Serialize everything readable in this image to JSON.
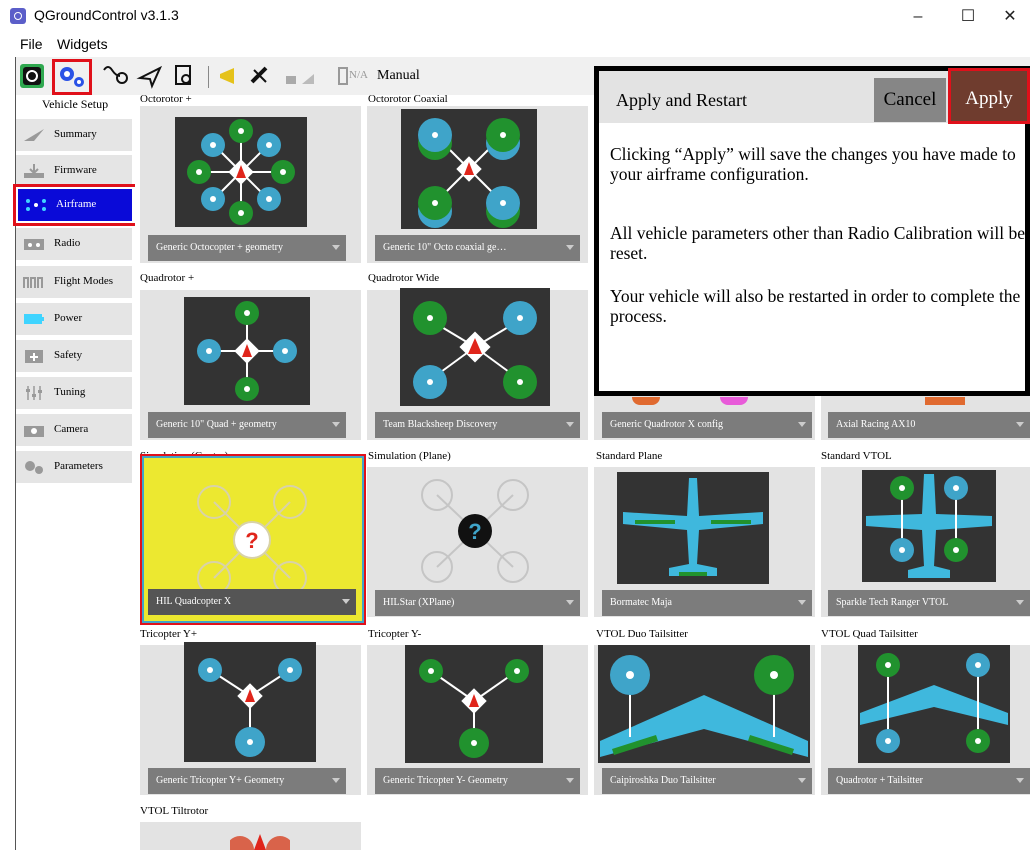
{
  "window": {
    "title": "QGroundControl v3.1.3",
    "minimize": "–",
    "maximize": "☐",
    "close": "✕"
  },
  "menu": {
    "file": "File",
    "widgets": "Widgets"
  },
  "toolbar": {
    "battery": "N/A",
    "mode": "Manual"
  },
  "nav": {
    "header": "Vehicle Setup",
    "items": [
      "Summary",
      "Firmware",
      "Airframe",
      "Radio",
      "Flight Modes",
      "Power",
      "Safety",
      "Tuning",
      "Camera",
      "Parameters"
    ],
    "selected": "Airframe"
  },
  "airframes": {
    "row0": [
      {
        "title": "Octorotor +",
        "combo": "Generic Octocopter + geometry"
      },
      {
        "title": "Octorotor Coaxial",
        "combo": "Generic 10\" Octo coaxial ge…"
      }
    ],
    "row1": [
      {
        "title": "Quadrotor +",
        "combo": "Generic 10\" Quad + geometry"
      },
      {
        "title": "Quadrotor Wide",
        "combo": "Team Blacksheep Discovery"
      },
      {
        "title": "",
        "combo": "Generic Quadrotor X config"
      },
      {
        "title": "",
        "combo": "Axial Racing AX10"
      }
    ],
    "row2": [
      {
        "title": "Simulation (Copter)",
        "combo": "HIL Quadcopter X"
      },
      {
        "title": "Simulation (Plane)",
        "combo": "HILStar (XPlane)"
      },
      {
        "title": "Standard Plane",
        "combo": "Bormatec Maja"
      },
      {
        "title": "Standard VTOL",
        "combo": "Sparkle Tech Ranger VTOL"
      }
    ],
    "row3": [
      {
        "title": "Tricopter Y+",
        "combo": "Generic Tricopter Y+ Geometry"
      },
      {
        "title": "Tricopter Y-",
        "combo": "Generic Tricopter Y- Geometry"
      },
      {
        "title": "VTOL Duo Tailsitter",
        "combo": "Caipiroshka Duo Tailsitter"
      },
      {
        "title": "VTOL Quad Tailsitter",
        "combo": "Quadrotor + Tailsitter"
      }
    ],
    "row4": [
      {
        "title": "VTOL Tiltrotor"
      }
    ]
  },
  "dialog": {
    "title": "Apply and Restart",
    "cancel": "Cancel",
    "apply": "Apply",
    "para1": "Clicking “Apply” will save the changes you have made to your airframe configuration.",
    "para2": "All vehicle parameters other than Radio Calibration will be reset.",
    "para3": "Your vehicle will also be restarted in order to complete the process."
  },
  "colors": {
    "selected_nav": "#0a0ad8",
    "highlight": "#e0101a",
    "sim_bg": "#ece830",
    "motor_green": "#21922e",
    "motor_blue": "#3fa4c9",
    "dialog_apply": "#6f3c2e"
  }
}
